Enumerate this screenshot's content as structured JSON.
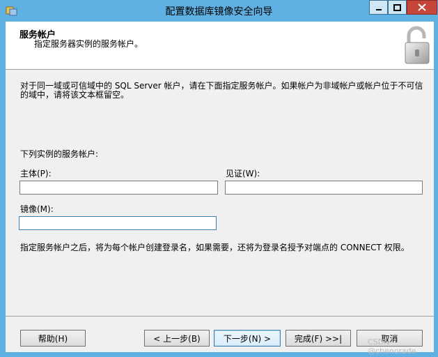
{
  "window": {
    "title": "配置数据库镜像安全向导",
    "colors": {
      "frame": "#5fb1e4",
      "close": "#c7463c"
    }
  },
  "header": {
    "title": "服务帐户",
    "subtitle": "指定服务器实例的服务帐户。",
    "icon": "padlock-icon"
  },
  "body": {
    "description": "对于同一域或可信域中的 SQL Server 帐户，请在下面指定服务帐户。如果帐户为非域帐户或帐户位于不可信的域中，请将该文本框留空。",
    "section_label": "下列实例的服务帐户:",
    "principal_label": "主体(P):",
    "principal_value": "",
    "witness_label": "见证(W):",
    "witness_value": "",
    "mirror_label": "镜像(M):",
    "mirror_value": "",
    "note": "指定服务帐户之后，将为每个帐户创建登录名，如果需要，还将为登录名授予对端点的 CONNECT 权限。"
  },
  "buttons": {
    "help": "帮助(H)",
    "back": "< 上一步(B)",
    "next": "下一步(N) >",
    "finish": "完成(F) >>|",
    "cancel": "取消"
  },
  "watermark": "CSDN @chenorade"
}
